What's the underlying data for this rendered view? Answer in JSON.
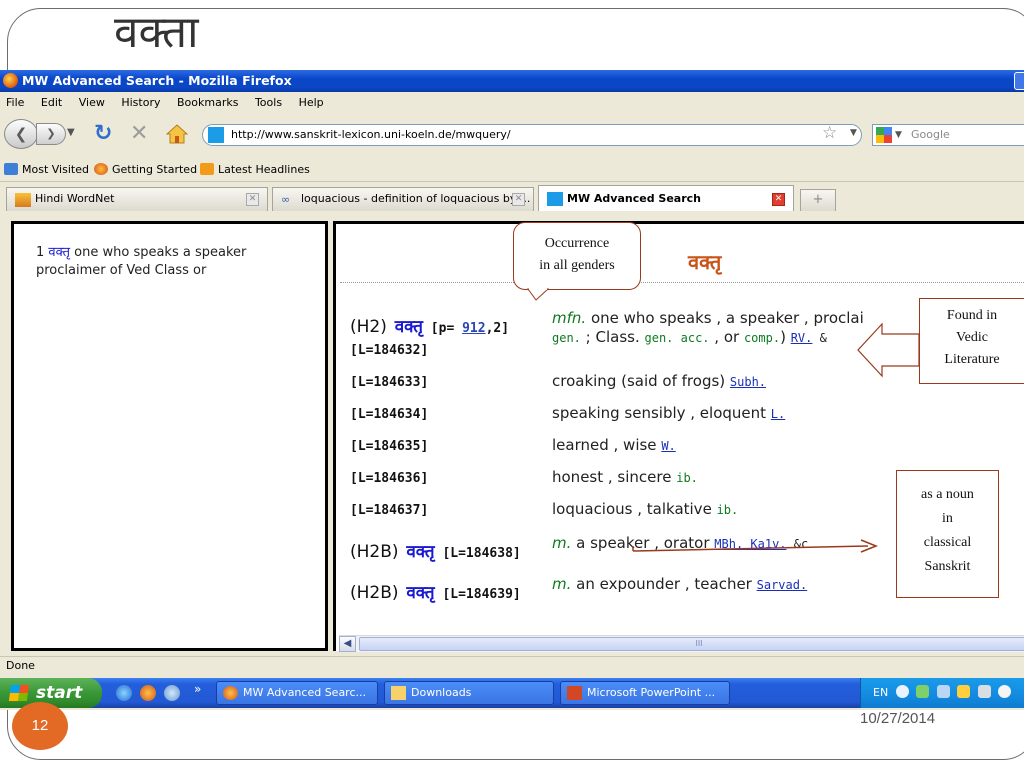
{
  "slide": {
    "title": "वक्ता",
    "page_number": "12",
    "date": "10/27/2014"
  },
  "window": {
    "title": "MW Advanced Search - Mozilla Firefox"
  },
  "menu": [
    "File",
    "Edit",
    "View",
    "History",
    "Bookmarks",
    "Tools",
    "Help"
  ],
  "nav": {
    "url": "http://www.sanskrit-lexicon.uni-koeln.de/mwquery/",
    "search_placeholder": "Google"
  },
  "bookmarks": [
    "Most Visited",
    "Getting Started",
    "Latest Headlines"
  ],
  "tabs": [
    {
      "label": "Hindi WordNet",
      "active": false
    },
    {
      "label": "loquacious - definition of loquacious by ...",
      "active": false
    },
    {
      "label": "MW Advanced Search",
      "active": true
    }
  ],
  "left_frame": {
    "entry_number": "1",
    "headword": "वक्तृ",
    "text": " one who speaks a speaker proclaimer of Ved Class or"
  },
  "right_frame": {
    "headword": "वक्तृ",
    "rows": [
      {
        "label_type": "(H2)",
        "label_dev": "वक्तृ",
        "label_rest": "[p= ",
        "label_link": "912",
        "label_tail": ",2]",
        "label2": "[L=184632]",
        "def_italic": "mfn.",
        "def_text": " one who speaks , a speaker , proclai",
        "def2_a": "gen.",
        "def2_b": " ; Class. ",
        "def2_c": "gen. acc.",
        "def2_d": " , or ",
        "def2_e": "comp.",
        "def2_f": ") ",
        "def2_link": "RV.",
        "def2_tail": " &"
      },
      {
        "label": "[L=184633]",
        "def_text": "croaking (said of frogs) ",
        "def_link": "Subh."
      },
      {
        "label": "[L=184634]",
        "def_text": "speaking sensibly , eloquent ",
        "def_link": "L."
      },
      {
        "label": "[L=184635]",
        "def_text": "learned , wise ",
        "def_link": "W."
      },
      {
        "label": "[L=184636]",
        "def_text": "honest , sincere ",
        "def_small": "ib."
      },
      {
        "label": "[L=184637]",
        "def_text": "loquacious , talkative ",
        "def_small": "ib."
      },
      {
        "label_type": "(H2B)",
        "label_dev": "वक्तृ",
        "label_rest": "[L=184638]",
        "def_italic": "m.",
        "def_text": " a speaker , orator ",
        "def_link": "MBh. Ka1v.",
        "def_small": " &c"
      },
      {
        "label_type": "(H2B)",
        "label_dev": "वक्तृ",
        "label_rest": "[L=184639]",
        "def_italic": "m.",
        "def_text": " an expounder , teacher ",
        "def_link": "Sarvad."
      }
    ],
    "scroll_grip": "III"
  },
  "callouts": {
    "occurrence": [
      "Occurrence",
      "in all genders"
    ],
    "vedic": [
      "Found in",
      "Vedic",
      "Literature"
    ],
    "noun": [
      "as a noun",
      "in",
      "classical",
      "Sanskrit"
    ]
  },
  "status": "Done",
  "taskbar": {
    "start": "start",
    "chevrons": "»",
    "items": [
      "MW Advanced Searc...",
      "Downloads",
      "Microsoft PowerPoint ..."
    ],
    "tray_lang": "EN"
  },
  "colors": {
    "titlebar": "#0a47c9",
    "headword": "#c9541a",
    "devanagari": "#1a1ad0",
    "grammar": "#0f7a1f",
    "callout_border": "#9a3a1a",
    "page_badge": "#e26a25"
  }
}
